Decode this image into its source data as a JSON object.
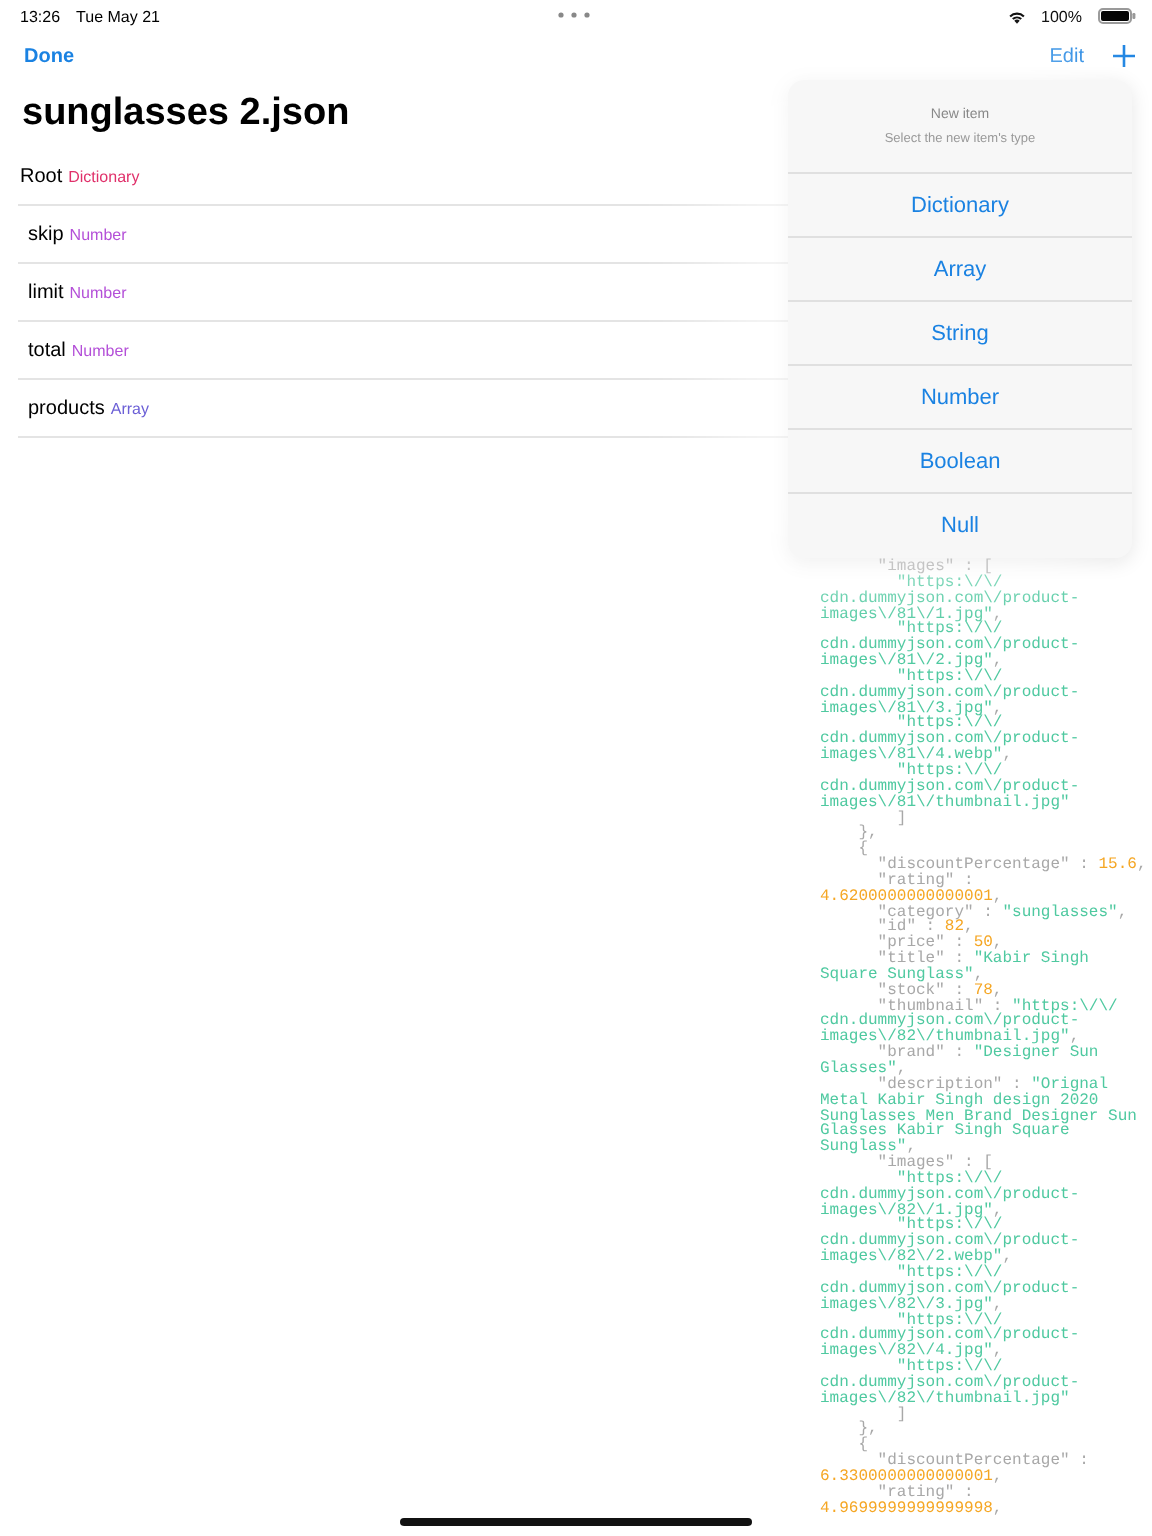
{
  "status_bar": {
    "time": "13:26",
    "date": "Tue May 21",
    "battery": "100%"
  },
  "nav": {
    "done": "Done",
    "edit": "Edit"
  },
  "title": "sunglasses 2.json",
  "tree": {
    "name": "Root",
    "type": "Dictionary",
    "color": "#e0306a",
    "children": [
      {
        "name": "skip",
        "type": "Number",
        "color": "#b450d8"
      },
      {
        "name": "limit",
        "type": "Number",
        "color": "#b450d8"
      },
      {
        "name": "total",
        "type": "Number",
        "color": "#b450d8"
      },
      {
        "name": "products",
        "type": "Array",
        "color": "#6b5fd6"
      }
    ]
  },
  "popover": {
    "title": "New item",
    "subtitle": "Select the new item's type",
    "options": [
      "Dictionary",
      "Array",
      "String",
      "Number",
      "Boolean",
      "Null"
    ]
  },
  "code_lines": [
    [
      {
        "kind": "key",
        "text": "      \"images\" : ["
      }
    ],
    [
      {
        "kind": "string",
        "text": "        \"https:\\/\\/"
      }
    ],
    [
      {
        "kind": "string",
        "text": "cdn.dummyjson.com\\/product-"
      }
    ],
    [
      {
        "kind": "string",
        "text": "images\\/81\\/1.jpg\""
      },
      {
        "kind": "key",
        "text": ","
      }
    ],
    [
      {
        "kind": "string",
        "text": "        \"https:\\/\\/"
      }
    ],
    [
      {
        "kind": "string",
        "text": "cdn.dummyjson.com\\/product-"
      }
    ],
    [
      {
        "kind": "string",
        "text": "images\\/81\\/2.jpg\""
      },
      {
        "kind": "key",
        "text": ","
      }
    ],
    [
      {
        "kind": "string",
        "text": "        \"https:\\/\\/"
      }
    ],
    [
      {
        "kind": "string",
        "text": "cdn.dummyjson.com\\/product-"
      }
    ],
    [
      {
        "kind": "string",
        "text": "images\\/81\\/3.jpg\""
      },
      {
        "kind": "key",
        "text": ","
      }
    ],
    [
      {
        "kind": "string",
        "text": "        \"https:\\/\\/"
      }
    ],
    [
      {
        "kind": "string",
        "text": "cdn.dummyjson.com\\/product-"
      }
    ],
    [
      {
        "kind": "string",
        "text": "images\\/81\\/4.webp\""
      },
      {
        "kind": "key",
        "text": ","
      }
    ],
    [
      {
        "kind": "string",
        "text": "        \"https:\\/\\/"
      }
    ],
    [
      {
        "kind": "string",
        "text": "cdn.dummyjson.com\\/product-"
      }
    ],
    [
      {
        "kind": "string",
        "text": "images\\/81\\/thumbnail.jpg\""
      }
    ],
    [
      {
        "kind": "key",
        "text": "        ]"
      }
    ],
    [
      {
        "kind": "key",
        "text": "    },"
      }
    ],
    [
      {
        "kind": "key",
        "text": "    {"
      }
    ],
    [
      {
        "kind": "key",
        "text": "      \"discountPercentage\" : "
      },
      {
        "kind": "number",
        "text": "15.6"
      },
      {
        "kind": "key",
        "text": ","
      }
    ],
    [
      {
        "kind": "key",
        "text": "      \"rating\" :"
      }
    ],
    [
      {
        "kind": "number",
        "text": "4.6200000000000001"
      },
      {
        "kind": "key",
        "text": ","
      }
    ],
    [
      {
        "kind": "key",
        "text": "      \"category\" : "
      },
      {
        "kind": "string",
        "text": "\"sunglasses\""
      },
      {
        "kind": "key",
        "text": ","
      }
    ],
    [
      {
        "kind": "key",
        "text": "      \"id\" : "
      },
      {
        "kind": "number",
        "text": "82"
      },
      {
        "kind": "key",
        "text": ","
      }
    ],
    [
      {
        "kind": "key",
        "text": "      \"price\" : "
      },
      {
        "kind": "number",
        "text": "50"
      },
      {
        "kind": "key",
        "text": ","
      }
    ],
    [
      {
        "kind": "key",
        "text": "      \"title\" : "
      },
      {
        "kind": "string",
        "text": "\"Kabir Singh"
      }
    ],
    [
      {
        "kind": "string",
        "text": "Square Sunglass\""
      },
      {
        "kind": "key",
        "text": ","
      }
    ],
    [
      {
        "kind": "key",
        "text": "      \"stock\" : "
      },
      {
        "kind": "number",
        "text": "78"
      },
      {
        "kind": "key",
        "text": ","
      }
    ],
    [
      {
        "kind": "key",
        "text": "      \"thumbnail\" : "
      },
      {
        "kind": "string",
        "text": "\"https:\\/\\/"
      }
    ],
    [
      {
        "kind": "string",
        "text": "cdn.dummyjson.com\\/product-"
      }
    ],
    [
      {
        "kind": "string",
        "text": "images\\/82\\/thumbnail.jpg\""
      },
      {
        "kind": "key",
        "text": ","
      }
    ],
    [
      {
        "kind": "key",
        "text": "      \"brand\" : "
      },
      {
        "kind": "string",
        "text": "\"Designer Sun"
      }
    ],
    [
      {
        "kind": "string",
        "text": "Glasses\""
      },
      {
        "kind": "key",
        "text": ","
      }
    ],
    [
      {
        "kind": "key",
        "text": "      \"description\" : "
      },
      {
        "kind": "string",
        "text": "\"Orignal"
      }
    ],
    [
      {
        "kind": "string",
        "text": "Metal Kabir Singh design 2020"
      }
    ],
    [
      {
        "kind": "string",
        "text": "Sunglasses Men Brand Designer Sun"
      }
    ],
    [
      {
        "kind": "string",
        "text": "Glasses Kabir Singh Square"
      }
    ],
    [
      {
        "kind": "string",
        "text": "Sunglass\""
      },
      {
        "kind": "key",
        "text": ","
      }
    ],
    [
      {
        "kind": "key",
        "text": "      \"images\" : ["
      }
    ],
    [
      {
        "kind": "string",
        "text": "        \"https:\\/\\/"
      }
    ],
    [
      {
        "kind": "string",
        "text": "cdn.dummyjson.com\\/product-"
      }
    ],
    [
      {
        "kind": "string",
        "text": "images\\/82\\/1.jpg\""
      },
      {
        "kind": "key",
        "text": ","
      }
    ],
    [
      {
        "kind": "string",
        "text": "        \"https:\\/\\/"
      }
    ],
    [
      {
        "kind": "string",
        "text": "cdn.dummyjson.com\\/product-"
      }
    ],
    [
      {
        "kind": "string",
        "text": "images\\/82\\/2.webp\""
      },
      {
        "kind": "key",
        "text": ","
      }
    ],
    [
      {
        "kind": "string",
        "text": "        \"https:\\/\\/"
      }
    ],
    [
      {
        "kind": "string",
        "text": "cdn.dummyjson.com\\/product-"
      }
    ],
    [
      {
        "kind": "string",
        "text": "images\\/82\\/3.jpg\""
      },
      {
        "kind": "key",
        "text": ","
      }
    ],
    [
      {
        "kind": "string",
        "text": "        \"https:\\/\\/"
      }
    ],
    [
      {
        "kind": "string",
        "text": "cdn.dummyjson.com\\/product-"
      }
    ],
    [
      {
        "kind": "string",
        "text": "images\\/82\\/4.jpg\""
      },
      {
        "kind": "key",
        "text": ","
      }
    ],
    [
      {
        "kind": "string",
        "text": "        \"https:\\/\\/"
      }
    ],
    [
      {
        "kind": "string",
        "text": "cdn.dummyjson.com\\/product-"
      }
    ],
    [
      {
        "kind": "string",
        "text": "images\\/82\\/thumbnail.jpg\""
      }
    ],
    [
      {
        "kind": "key",
        "text": "        ]"
      }
    ],
    [
      {
        "kind": "key",
        "text": "    },"
      }
    ],
    [
      {
        "kind": "key",
        "text": "    {"
      }
    ],
    [
      {
        "kind": "key",
        "text": "      \"discountPercentage\" :"
      }
    ],
    [
      {
        "kind": "number",
        "text": "6.3300000000000001"
      },
      {
        "kind": "key",
        "text": ","
      }
    ],
    [
      {
        "kind": "key",
        "text": "      \"rating\" :"
      }
    ],
    [
      {
        "kind": "number",
        "text": "4.9699999999999998"
      },
      {
        "kind": "key",
        "text": ","
      }
    ]
  ]
}
